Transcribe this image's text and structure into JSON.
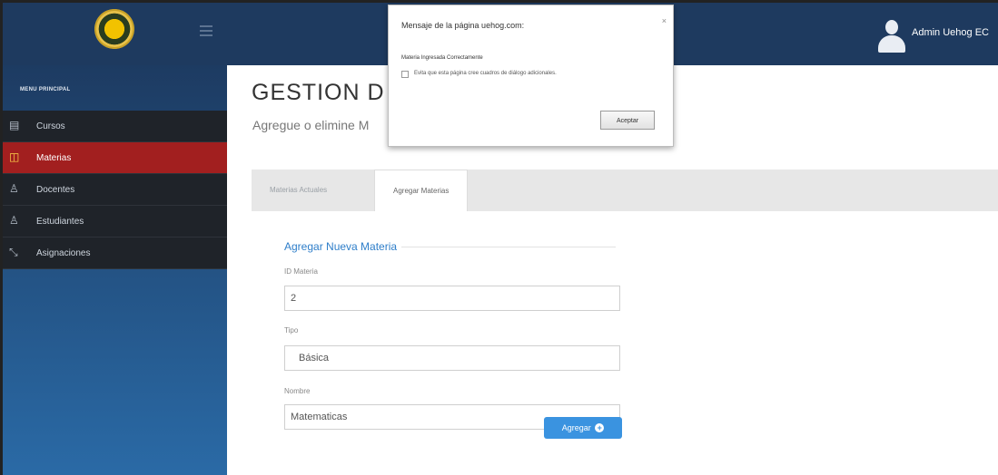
{
  "header": {
    "user_name": "Admin Uehog EC"
  },
  "sidebar": {
    "menu_header": "MENU PRINCIPAL",
    "items": [
      {
        "label": "Cursos",
        "icon": "book-icon"
      },
      {
        "label": "Materias",
        "icon": "columns-icon"
      },
      {
        "label": "Docentes",
        "icon": "user-icon"
      },
      {
        "label": "Estudiantes",
        "icon": "user-icon"
      },
      {
        "label": "Asignaciones",
        "icon": "link-icon"
      }
    ],
    "active_index": 1
  },
  "main": {
    "title": "GESTION D",
    "subtitle": "Agregue o elimine M",
    "tabs": [
      {
        "label": "Materias Actuales"
      },
      {
        "label": "Agregar Materias"
      }
    ],
    "form": {
      "legend": "Agregar Nueva Materia",
      "id_label": "ID Materia",
      "id_value": "2",
      "type_label": "Tipo",
      "type_value": "Básica",
      "name_label": "Nombre",
      "name_value": "Matematicas",
      "submit_label": "Agregar"
    }
  },
  "dialog": {
    "title": "Mensaje de la página uehog.com:",
    "message": "Materia Ingresada Correctamente",
    "checkbox_label": "Evita que esta página cree cuadros de diálogo adicionales.",
    "accept_label": "Aceptar",
    "close_label": "×"
  },
  "colors": {
    "topbar": "#1e3a5f",
    "active_menu": "#a21f1f",
    "accent": "#3a93e0"
  }
}
